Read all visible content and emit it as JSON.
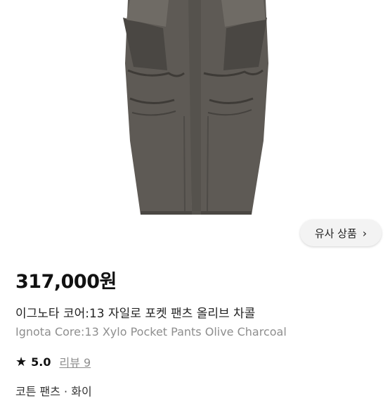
{
  "product": {
    "similar_button_label": "유사 상품",
    "similar_button_chevron": "›",
    "price": "317,000원",
    "title_ko": "이그노타 코어:13 자일로 포켓 팬츠 올리브 차콜",
    "title_en": "Ignota Core:13 Xylo Pocket Pants Olive Charcoal",
    "rating_star": "★",
    "rating_score": "5.0",
    "reviews_label": "리뷰 9",
    "category_partial": "코튼 팬츠 · 화이"
  },
  "colors": {
    "pants": "#5e5a55",
    "pants_dark": "#4a4743",
    "pants_light": "#6f6b65"
  }
}
